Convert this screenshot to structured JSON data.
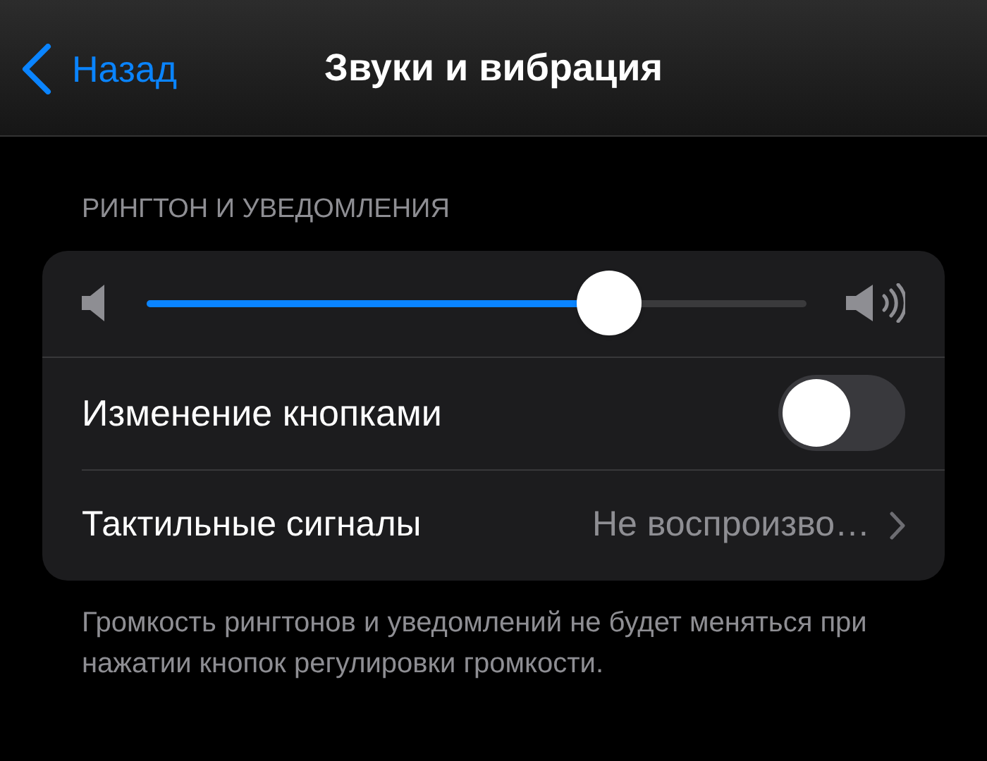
{
  "nav": {
    "back_label": "Назад",
    "title": "Звуки и вибрация"
  },
  "section": {
    "header": "РИНГТОН И УВЕДОМЛЕНИЯ",
    "rows": [
      {
        "kind": "slider",
        "level": 0.7
      },
      {
        "kind": "toggle",
        "label": "Изменение кнопками",
        "on": false
      },
      {
        "kind": "link",
        "label": "Тактильные сигналы",
        "value": "Не воспроизво…"
      }
    ],
    "footer": "Громкость рингтонов и уведомлений не будет меняться при нажатии кнопок регулировки громкости."
  }
}
